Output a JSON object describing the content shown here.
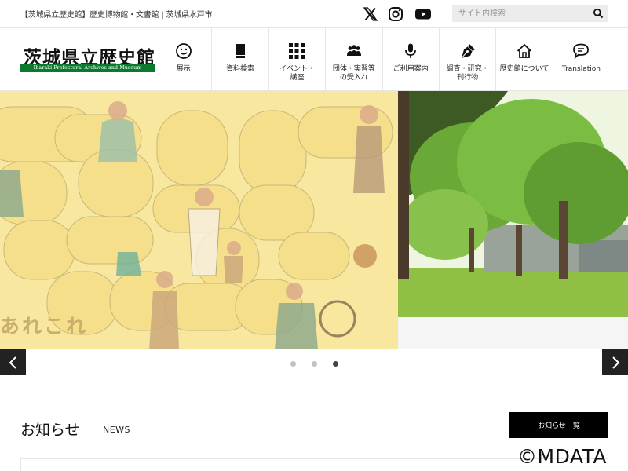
{
  "topbar": {
    "tagline": "【茨城県立歴史館】歴史博物館・文書館 | 茨城県水戸市",
    "social": [
      {
        "icon": "x-icon",
        "label": "X"
      },
      {
        "icon": "instagram-icon",
        "label": "Instagram"
      },
      {
        "icon": "youtube-icon",
        "label": "YouTube"
      }
    ],
    "search": {
      "placeholder": "サイト内検索",
      "value": "",
      "icon": "search-icon"
    }
  },
  "logo": {
    "jp": "茨城県立歴史館",
    "en": "Ibaraki Prefectural Archives and Museum",
    "brand_green": "#0c7a2e"
  },
  "nav": [
    {
      "icon": "smile-icon",
      "label": "展示"
    },
    {
      "icon": "book-icon",
      "label": "資料検索"
    },
    {
      "icon": "grid-icon",
      "label": "イベント・\n講座"
    },
    {
      "icon": "group-icon",
      "label": "団体・実習等\nの受入れ"
    },
    {
      "icon": "microphone-icon",
      "label": "ご利用案内"
    },
    {
      "icon": "pen-nib-icon",
      "label": "調査・研究・\n刊行物"
    },
    {
      "icon": "home-icon",
      "label": "歴史館について"
    },
    {
      "icon": "speech-bubble-icon",
      "label": "Translation"
    }
  ],
  "hero": {
    "caption": "あれこれ",
    "slides": 3,
    "active_slide": 3,
    "colors": {
      "illustration_bg": "#f8e79e",
      "arrow_bg": "#222222"
    }
  },
  "news": {
    "title": "お知らせ",
    "subtitle": "NEWS",
    "list_button": "お知らせ一覧"
  },
  "watermark": "©MDATA"
}
